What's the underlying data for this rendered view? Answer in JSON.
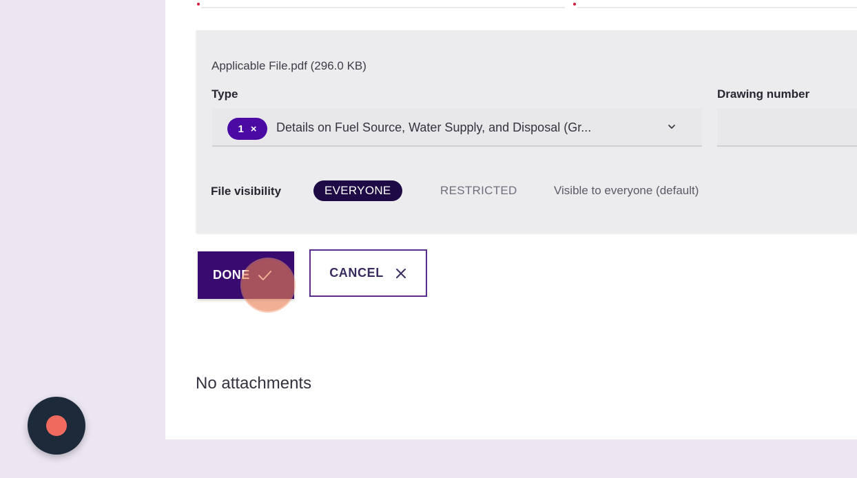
{
  "upload": {
    "file_name": "Applicable File.pdf (296.0 KB)",
    "type_label": "Type",
    "type_chip_count": "1",
    "type_chip_remove": "×",
    "type_value": "Details on Fuel Source, Water Supply, and Disposal (Gr...",
    "drawing_number_label": "Drawing number",
    "drawing_number_value": "",
    "visibility_label": "File visibility",
    "visibility_options": [
      "EVERYONE",
      "RESTRICTED"
    ],
    "visibility_selected": "EVERYONE",
    "visibility_help": "Visible to everyone (default)"
  },
  "actions": {
    "done_label": "DONE",
    "cancel_label": "CANCEL"
  },
  "attachments": {
    "empty_text": "No attachments"
  },
  "colors": {
    "accent": "#4b0aa3",
    "done_bg": "#3a0b6e",
    "visibility_active_bg": "#1e0b45",
    "required": "#d81b3c",
    "record": "#f06a5e"
  },
  "icons": {
    "chevron": "chevron-down-icon",
    "check": "check-icon",
    "close": "close-icon",
    "record": "record-icon"
  }
}
